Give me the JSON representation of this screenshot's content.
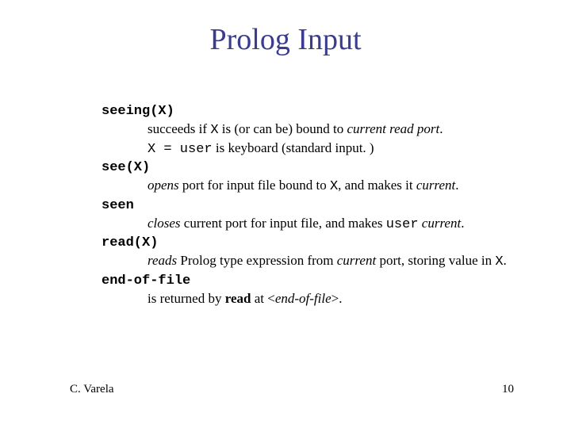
{
  "title": "Prolog Input",
  "items": {
    "seeing": {
      "head": "seeing(X)",
      "desc_pre": "succeeds if ",
      "code1": "X",
      "desc_mid": " is (or can be) bound to ",
      "italic1": "current read port",
      "desc_end": ".",
      "line2_code": "X = user",
      "line2_rest": " is keyboard (standard input. )"
    },
    "see": {
      "head": "see(X)",
      "italic1": "opens",
      "mid1": " port for input file bound to ",
      "code1": "X",
      "mid2": ", and makes it ",
      "italic2": "current",
      "end": "."
    },
    "seen": {
      "head": "seen",
      "italic1": "closes",
      "mid1": " current port for input file, and makes ",
      "code1": "user",
      "mid2": " ",
      "italic2": "current",
      "end": "."
    },
    "read": {
      "head": "read(X)",
      "italic1": "reads",
      "mid1": " Prolog type expression from ",
      "italic2": "current",
      "mid2": " port, storing value in ",
      "code1": "X",
      "end": "."
    },
    "eof": {
      "head": "end-of-file",
      "pre": "is returned by ",
      "bold": "read",
      "mid": " at <",
      "italic": "end-of-file",
      "end": ">."
    }
  },
  "footer": {
    "author": "C. Varela",
    "page": "10"
  }
}
